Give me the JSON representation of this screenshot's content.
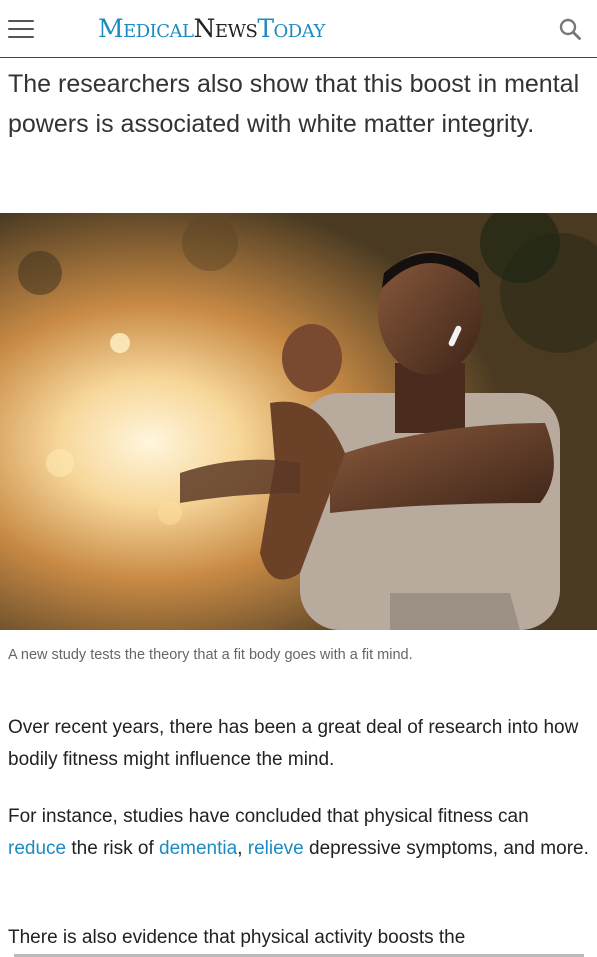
{
  "header": {
    "logo": {
      "part1": "Medical",
      "part2": "News",
      "part3": "Today"
    },
    "menu_icon": "hamburger-menu-icon",
    "search_icon": "search-icon"
  },
  "article": {
    "lede": "The researchers also show that this boost in mental powers is associated with white matter integrity.",
    "image": {
      "caption": "A new study tests the theory that a fit body goes with a fit mind."
    },
    "paragraphs": {
      "p1": "Over recent years, there has been a great deal of research into how bodily fitness might influence the mind.",
      "p2": {
        "t1": "For instance, studies have concluded that physical fitness can ",
        "link1": "reduce",
        "t2": " the risk of ",
        "link2": "dementia",
        "t3": ", ",
        "link3": "relieve",
        "t4": " depressive symptoms, and more."
      },
      "p3": "There is also evidence that physical activity boosts the"
    }
  },
  "colors": {
    "brand_blue": "#1b8bc2",
    "text": "#222222",
    "caption": "#666666"
  }
}
